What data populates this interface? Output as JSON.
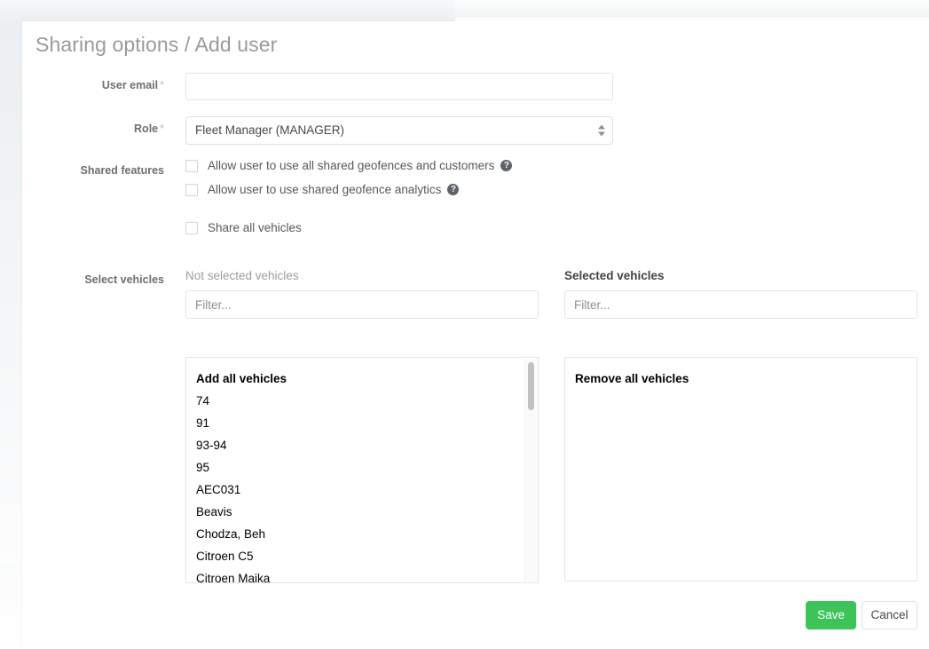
{
  "title": "Sharing options / Add user",
  "form": {
    "user_email": {
      "label": "User email",
      "required_mark": "*",
      "value": "",
      "placeholder": ""
    },
    "role": {
      "label": "Role",
      "required_mark": "*",
      "selected": "Fleet Manager (MANAGER)"
    },
    "shared_features": {
      "label": "Shared features",
      "options": [
        {
          "text": "Allow user to use all shared geofences and customers",
          "checked": false,
          "help": "?"
        },
        {
          "text": "Allow user to use shared geofence analytics",
          "checked": false,
          "help": "?"
        }
      ],
      "share_all": {
        "text": "Share all vehicles",
        "checked": false
      }
    },
    "select_vehicles": {
      "label": "Select vehicles",
      "not_selected": {
        "heading": "Not selected vehicles",
        "filter_placeholder": "Filter...",
        "filter_value": "",
        "bulk_action": "Add all vehicles",
        "items": [
          "74",
          "91",
          "93-94",
          "95",
          "AEC031",
          "Beavis",
          "Chodza, Beh",
          "Citroen C5",
          "Citroen Maika"
        ]
      },
      "selected": {
        "heading": "Selected vehicles",
        "filter_placeholder": "Filter...",
        "filter_value": "",
        "bulk_action": "Remove all vehicles",
        "items": []
      }
    }
  },
  "footer": {
    "save_label": "Save",
    "cancel_label": "Cancel"
  },
  "colors": {
    "primary": "#3cc459",
    "title": "#9a9a9a",
    "label": "#6b6f73"
  }
}
